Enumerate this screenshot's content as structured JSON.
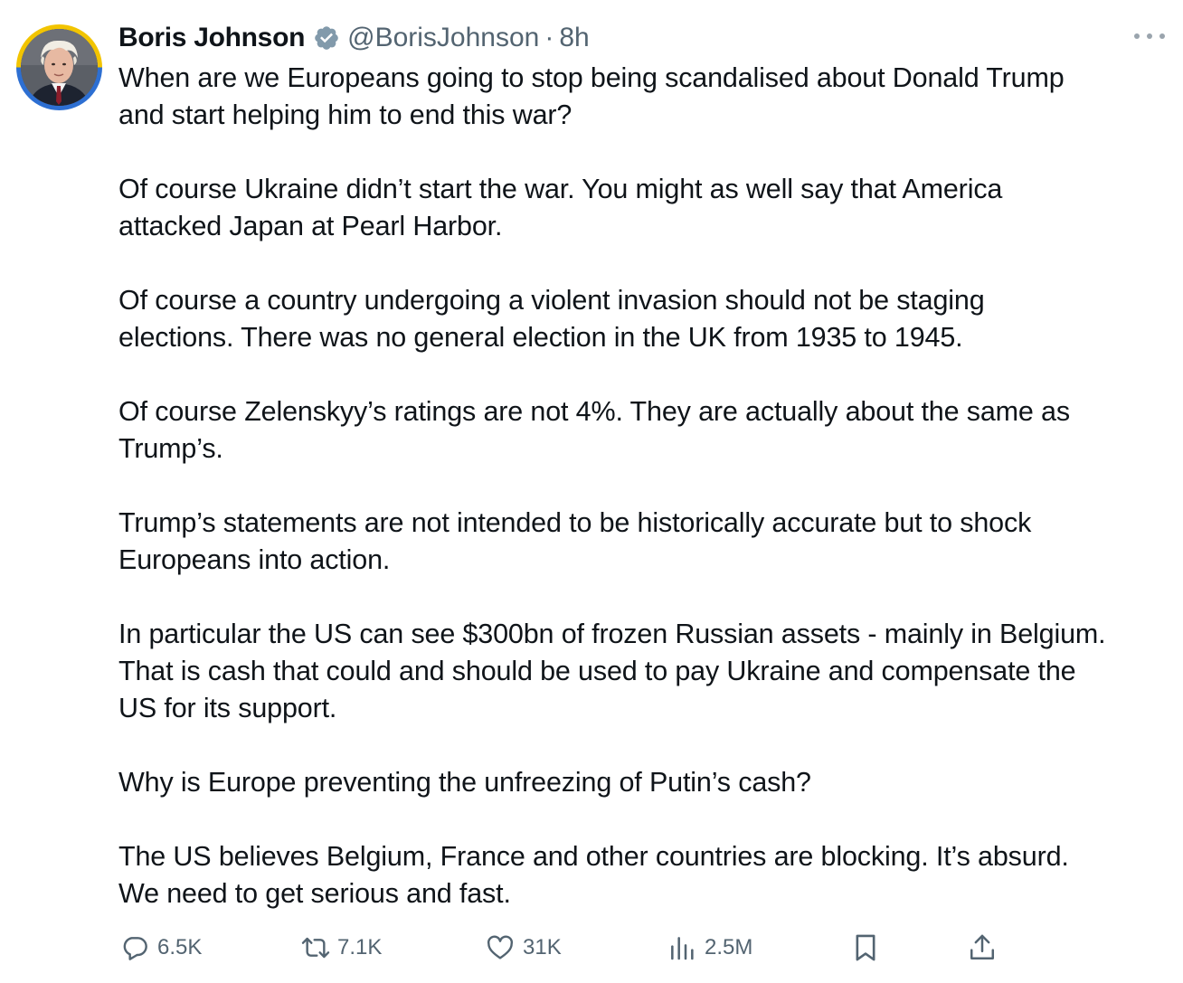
{
  "tweet": {
    "author_name": "Boris Johnson",
    "handle": "@BorisJohnson",
    "separator": "·",
    "time": "8h",
    "paragraphs": [
      "When are we Europeans going to stop being scandalised about Donald Trump\nand start helping him to end this war?",
      "Of course Ukraine didn’t start the war. You might as well say that America\nattacked Japan at Pearl Harbor.",
      "Of course a country undergoing a violent invasion should not be staging\nelections. There was no general election in the UK from 1935 to 1945.",
      "Of course Zelenskyy’s ratings are not 4%. They are actually about the same as\nTrump’s.",
      "Trump’s statements are not intended to be historically accurate but to shock\nEuropeans into action.",
      "In particular the US can see $300bn of frozen Russian assets - mainly in Belgium.\nThat is cash that could and should be used to pay Ukraine and compensate the\nUS for its support.",
      "Why is Europe preventing the unfreezing of Putin’s cash?",
      "The US believes Belgium, France and other countries are blocking. It’s absurd.\nWe need to get serious and fast."
    ]
  },
  "actions": {
    "replies": "6.5K",
    "reposts": "7.1K",
    "likes": "31K",
    "views": "2.5M"
  },
  "icons": {
    "reply": "speech-bubble-icon",
    "repost": "repost-arrows-icon",
    "like": "heart-icon",
    "views": "bar-chart-icon",
    "bookmark": "bookmark-icon",
    "share": "share-upload-icon",
    "verified": "verified-badge-icon",
    "more": "more-horizontal-icon"
  },
  "colors": {
    "text": "#0f1419",
    "secondary": "#536471",
    "verified_badge": "#829aab",
    "avatar_ring_top": "#2d6fd2",
    "avatar_ring_bottom": "#f2c400"
  }
}
